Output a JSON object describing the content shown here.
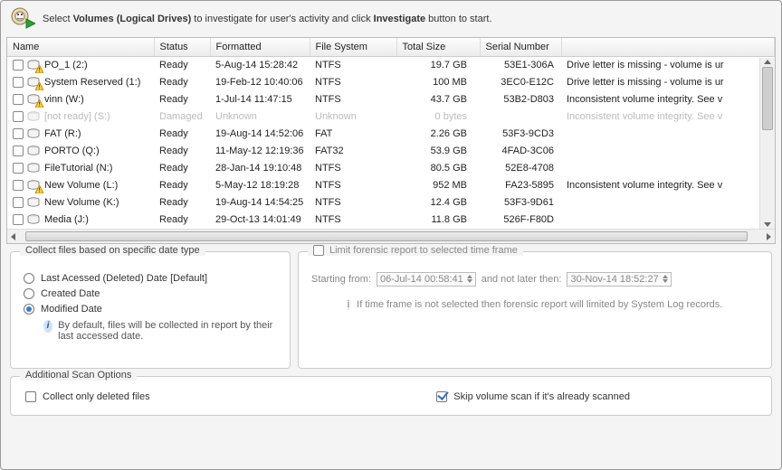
{
  "instruction": {
    "pre": "Select ",
    "bold1": "Volumes (Logical Drives)",
    "mid": " to investigate for user's activity and click ",
    "bold2": "Investigate",
    "post": " button to start."
  },
  "columns": {
    "name": "Name",
    "status": "Status",
    "formatted": "Formatted",
    "filesystem": "File System",
    "totalsize": "Total Size",
    "serial": "Serial Number"
  },
  "rows": [
    {
      "name": "PO_1 (2:)",
      "status": "Ready",
      "formatted": "5-Aug-14 15:28:42",
      "fs": "NTFS",
      "size": "19.7 GB",
      "serial": "53E1-306A",
      "note": "Drive letter is missing - volume is ur",
      "warn": true
    },
    {
      "name": "System Reserved (1:)",
      "status": "Ready",
      "formatted": "19-Feb-12 10:40:06",
      "fs": "NTFS",
      "size": "100 MB",
      "serial": "3EC0-E12C",
      "note": "Drive letter is missing - volume is ur",
      "warn": true
    },
    {
      "name": "vinn (W:)",
      "status": "Ready",
      "formatted": "1-Jul-14 11:47:15",
      "fs": "NTFS",
      "size": "43.7 GB",
      "serial": "53B2-D803",
      "note": "Inconsistent volume integrity. See v",
      "warn": true
    },
    {
      "name": "[not ready] (S:)",
      "status": "Damaged",
      "formatted": "Unknown",
      "fs": "Unknown",
      "size": "0 bytes",
      "serial": "",
      "note": "Inconsistent volume integrity. See v",
      "dim": true
    },
    {
      "name": "FAT (R:)",
      "status": "Ready",
      "formatted": "19-Aug-14 14:52:06",
      "fs": "FAT",
      "size": "2.26 GB",
      "serial": "53F3-9CD3",
      "note": ""
    },
    {
      "name": "PORTO (Q:)",
      "status": "Ready",
      "formatted": "11-May-12 12:19:36",
      "fs": "FAT32",
      "size": "53.9 GB",
      "serial": "4FAD-3C06",
      "note": ""
    },
    {
      "name": "FileTutorial (N:)",
      "status": "Ready",
      "formatted": "28-Jan-14 19:10:48",
      "fs": "NTFS",
      "size": "80.5 GB",
      "serial": "52E8-4708",
      "note": ""
    },
    {
      "name": "New Volume (L:)",
      "status": "Ready",
      "formatted": "5-May-12 18:19:28",
      "fs": "NTFS",
      "size": "952 MB",
      "serial": "FA23-5895",
      "note": "Inconsistent volume integrity. See v",
      "warn": true
    },
    {
      "name": "New Volume (K:)",
      "status": "Ready",
      "formatted": "19-Aug-14 14:54:25",
      "fs": "NTFS",
      "size": "12.4 GB",
      "serial": "53F3-9D61",
      "note": ""
    },
    {
      "name": "Media (J:)",
      "status": "Ready",
      "formatted": "29-Oct-13 14:01:49",
      "fs": "NTFS",
      "size": "11.8 GB",
      "serial": "526F-F80D",
      "note": ""
    }
  ],
  "dateGroup": {
    "legend": "Collect files based on specific date type",
    "opt_accessed": "Last Acessed (Deleted) Date [Default]",
    "opt_created": "Created Date",
    "opt_modified": "Modified Date",
    "hint": "By default, files will be collected in report by their last accessed date."
  },
  "timeGroup": {
    "legend": "Limit forensic report to selected time frame",
    "start_label": "Starting from:",
    "start_value": "06-Jul-14 00:58:41",
    "end_label": "and not later then:",
    "end_value": "30-Nov-14 18:52:27",
    "hint": "If time frame is not selected then forensic report will limited by System Log records."
  },
  "addl": {
    "legend": "Additional Scan Options",
    "opt_deleted": "Collect only deleted files",
    "opt_skip": "Skip volume scan if it's already scanned"
  }
}
